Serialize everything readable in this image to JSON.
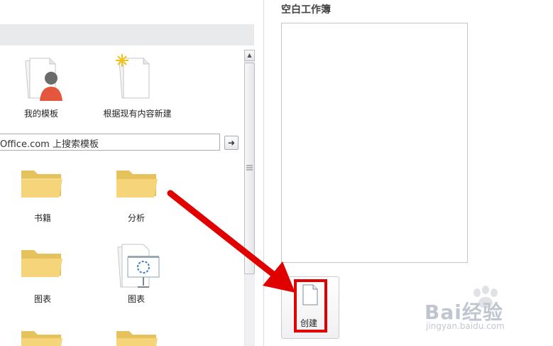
{
  "templates": {
    "items": [
      {
        "label": "我的模板",
        "icon": "my-templates-icon"
      },
      {
        "label": "根据现有内容新建",
        "icon": "new-from-existing-icon"
      }
    ]
  },
  "search": {
    "value": "Office.com 上搜索模板",
    "go_icon": "arrow-right-icon"
  },
  "folders": {
    "items": [
      {
        "label": "书籍",
        "icon": "folder-icon"
      },
      {
        "label": "分析",
        "icon": "folder-icon"
      },
      {
        "label": "图表",
        "icon": "folder-icon"
      },
      {
        "label": "图表",
        "icon": "presentation-board-icon"
      }
    ]
  },
  "preview": {
    "title": "空白工作簿"
  },
  "create": {
    "label": "创建",
    "icon": "blank-document-icon",
    "highlight_color": "#e00000"
  },
  "annotation": {
    "arrow_color": "#e00000"
  },
  "watermark": {
    "logo": "Bai经验",
    "url": "jingyan.baidu.com"
  }
}
